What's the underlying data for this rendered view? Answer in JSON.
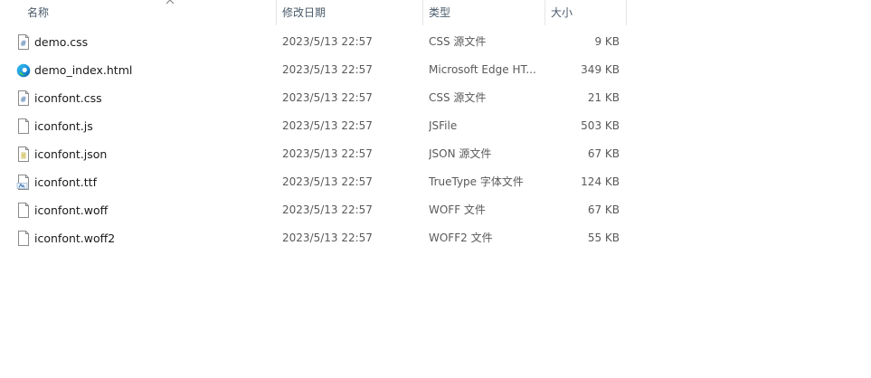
{
  "columns": {
    "name": "名称",
    "date": "修改日期",
    "type": "类型",
    "size": "大小"
  },
  "files": [
    {
      "name": "demo.css",
      "date": "2023/5/13 22:57",
      "type": "CSS 源文件",
      "size": "9 KB",
      "icon": "css-file-icon"
    },
    {
      "name": "demo_index.html",
      "date": "2023/5/13 22:57",
      "type": "Microsoft Edge HT...",
      "size": "349 KB",
      "icon": "edge-html-file-icon"
    },
    {
      "name": "iconfont.css",
      "date": "2023/5/13 22:57",
      "type": "CSS 源文件",
      "size": "21 KB",
      "icon": "css-file-icon"
    },
    {
      "name": "iconfont.js",
      "date": "2023/5/13 22:57",
      "type": "JSFile",
      "size": "503 KB",
      "icon": "blank-file-icon"
    },
    {
      "name": "iconfont.json",
      "date": "2023/5/13 22:57",
      "type": "JSON 源文件",
      "size": "67 KB",
      "icon": "json-file-icon"
    },
    {
      "name": "iconfont.ttf",
      "date": "2023/5/13 22:57",
      "type": "TrueType 字体文件",
      "size": "124 KB",
      "icon": "font-file-icon"
    },
    {
      "name": "iconfont.woff",
      "date": "2023/5/13 22:57",
      "type": "WOFF 文件",
      "size": "67 KB",
      "icon": "blank-file-icon"
    },
    {
      "name": "iconfont.woff2",
      "date": "2023/5/13 22:57",
      "type": "WOFF2 文件",
      "size": "55 KB",
      "icon": "blank-file-icon"
    }
  ]
}
